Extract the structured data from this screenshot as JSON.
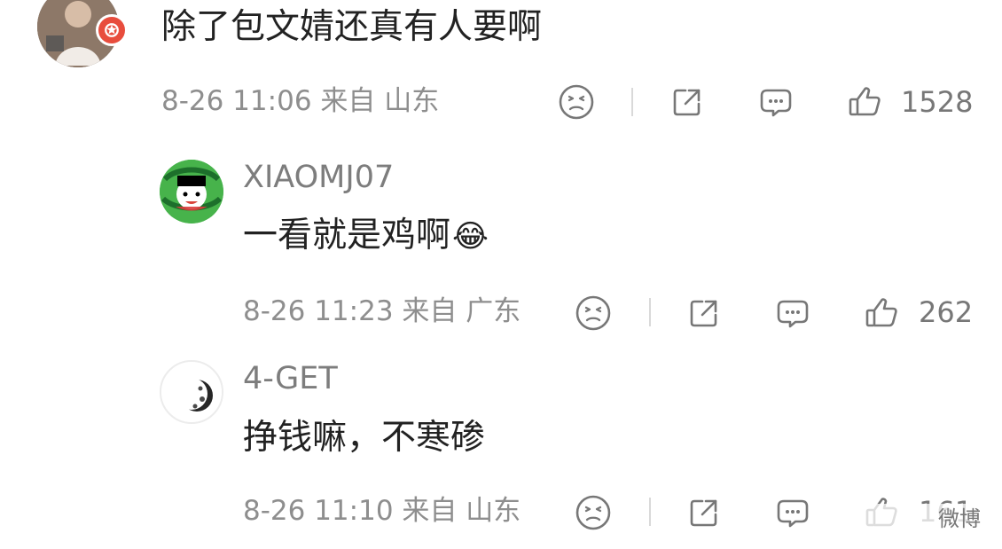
{
  "comments": [
    {
      "text": "除了包文婧还真有人要啊",
      "meta": "8-26 11:06 来自 山东",
      "likes": "1528"
    },
    {
      "username": "XIAOMJ07",
      "text": "一看就是鸡啊",
      "emoji": "😂",
      "meta": "8-26 11:23 来自 广东",
      "likes": "262"
    },
    {
      "username": "4-GET",
      "text": "挣钱嘛，不寒碜",
      "meta": "8-26 11:10 来自 山东",
      "likes": "161"
    }
  ],
  "watermark": {
    "label": "微博"
  },
  "colors": {
    "text": "#222222",
    "meta": "#8e8e8e",
    "icon": "#777777",
    "divider": "#d9d9d9",
    "badge": "#e84d3d"
  },
  "icons": [
    "neutral-face-icon",
    "share-icon",
    "comment-icon",
    "thumbs-up-icon",
    "user-badge-icon"
  ]
}
